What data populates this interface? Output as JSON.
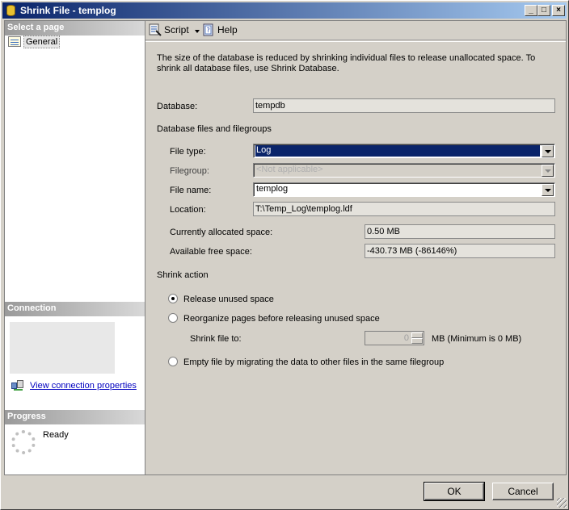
{
  "window": {
    "title": "Shrink File - templog",
    "controls": {
      "minimize": "_",
      "maximize": "□",
      "close": "×"
    }
  },
  "left_panel": {
    "select_page_header": "Select a page",
    "pages": [
      {
        "label": "General",
        "icon": "properties-page-icon",
        "selected": true
      }
    ],
    "connection_header": "Connection",
    "connection_link": "View connection properties",
    "progress_header": "Progress",
    "progress_status": "Ready"
  },
  "toolbar": {
    "script_label": "Script",
    "help_label": "Help"
  },
  "description": "The size of the database is reduced by shrinking individual files to release unallocated space. To shrink all database files, use Shrink Database.",
  "form": {
    "database_label": "Database:",
    "database_value": "tempdb",
    "files_group_label": "Database files and filegroups",
    "file_type_label": "File type:",
    "file_type_value": "Log",
    "filegroup_label": "Filegroup:",
    "filegroup_value": "<Not applicable>",
    "file_name_label": "File name:",
    "file_name_value": "templog",
    "location_label": "Location:",
    "location_value": "T:\\Temp_Log\\templog.ldf",
    "allocated_label": "Currently allocated space:",
    "allocated_value": "0.50 MB",
    "free_label": "Available free space:",
    "free_value": "-430.73 MB (-86146%)"
  },
  "shrink_action": {
    "header": "Shrink action",
    "options": [
      {
        "label": "Release unused space",
        "selected": true
      },
      {
        "label": "Reorganize pages before releasing unused space",
        "selected": false
      },
      {
        "label": "Empty file by migrating the data to other files in the same filegroup",
        "selected": false
      }
    ],
    "shrink_to_label": "Shrink file to:",
    "shrink_to_value": "0",
    "shrink_to_unit": "MB (Minimum is 0 MB)"
  },
  "buttons": {
    "ok": "OK",
    "cancel": "Cancel"
  }
}
